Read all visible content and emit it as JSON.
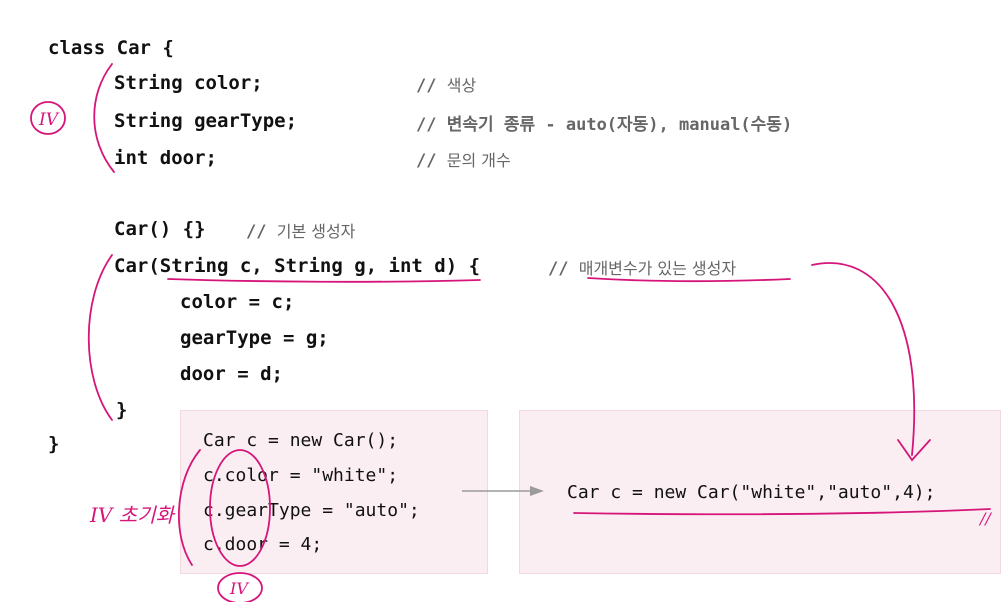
{
  "class_def": {
    "header": "class Car {",
    "fields": [
      {
        "code": "String color;",
        "comment_prefix": "// ",
        "comment": "색상"
      },
      {
        "code": "String gearType;",
        "comment_prefix": "// ",
        "comment": "변속기 종류 - auto(자동), manual(수동)"
      },
      {
        "code": "int door;",
        "comment_prefix": "// ",
        "comment": "문의 개수"
      }
    ],
    "ctor_default": {
      "code": "Car() {}",
      "comment_prefix": "// ",
      "comment": "기본 생성자"
    },
    "ctor_param": {
      "code": "Car(String c, String g, int d) {",
      "comment_prefix": "// ",
      "comment": "매개변수가 있는 생성자"
    },
    "ctor_body": [
      "color = c;",
      "gearType = g;",
      "door = d;"
    ],
    "ctor_close": "}",
    "class_close": "}"
  },
  "box_left": {
    "lines": [
      "Car c = new Car();",
      "c.color = \"white\";",
      "c.gearType = \"auto\";",
      "c.door = 4;"
    ]
  },
  "box_right": {
    "line": "Car c = new Car(\"white\",\"auto\",4);"
  },
  "annotations": {
    "iv_top": "IV",
    "iv_bottom": "IV",
    "iv_init": "IV 초기화",
    "equal_mark": "//"
  },
  "colors": {
    "ink": "#d6157a",
    "box_bg": "#fbeef2",
    "arrow": "#9a9a9a",
    "comment": "#666666"
  }
}
